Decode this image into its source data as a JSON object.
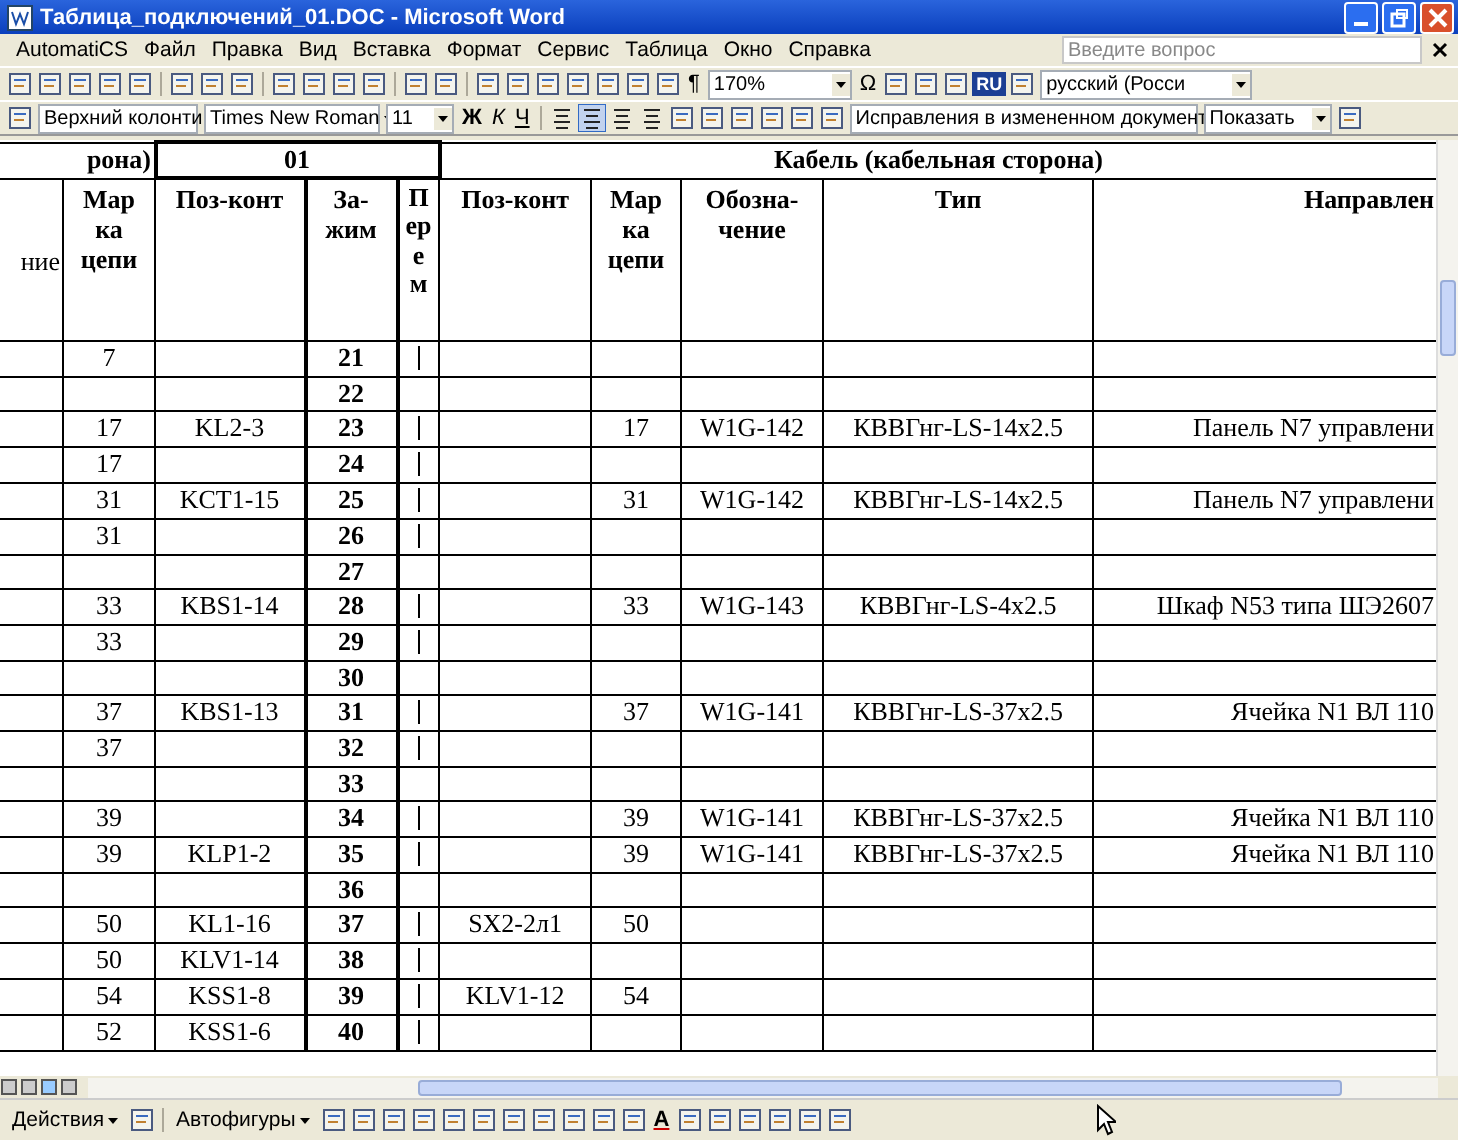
{
  "window": {
    "title": "Таблица_подключений_01.DOC - Microsoft Word"
  },
  "menu": [
    "AutomatiCS",
    "Файл",
    "Правка",
    "Вид",
    "Вставка",
    "Формат",
    "Сервис",
    "Таблица",
    "Окно",
    "Справка"
  ],
  "help_search": {
    "placeholder": "Введите вопрос"
  },
  "standard_toolbar": {
    "zoom": "170%",
    "omega": "Ω",
    "pilcrow": "¶",
    "language_badge": "RU",
    "language": "русский (Росси"
  },
  "formatting_toolbar": {
    "style": "Верхний колонти",
    "font": "Times New Roman",
    "size": "11",
    "bold": "Ж",
    "italic": "К",
    "underline": "Ч",
    "alignment_buttons": [
      {
        "selected": false
      },
      {
        "selected": true
      },
      {
        "selected": false
      },
      {
        "selected": false
      }
    ]
  },
  "reviewing_toolbar": {
    "display": "Исправления в измененном документ",
    "show": "Показать"
  },
  "table": {
    "header_groups": [
      {
        "label": "рона)"
      },
      {
        "label": "01"
      },
      {
        "label": "Кабель (кабельная сторона)"
      }
    ],
    "columns": [
      {
        "label": "ние",
        "kind": "plain"
      },
      {
        "label": "Мар\nка\nцепи",
        "kind": "plain"
      },
      {
        "label": "Поз-конт",
        "kind": "plain"
      },
      {
        "label": "За-\nжим",
        "kind": "terminal"
      },
      {
        "label": "Перем",
        "kind": "vertical"
      },
      {
        "label": "Поз-конт",
        "kind": "plain"
      },
      {
        "label": "Мар\nка\nцепи",
        "kind": "plain"
      },
      {
        "label": "Обозна-\nчение",
        "kind": "plain"
      },
      {
        "label": "Тип",
        "kind": "plain"
      },
      {
        "label": "Направлен",
        "kind": "right"
      }
    ],
    "rows": [
      {
        "mark": "7",
        "terminal": "21",
        "jumper": true
      },
      {
        "terminal": "22",
        "jumper": false
      },
      {
        "mark": "17",
        "pos": "KL2-3",
        "terminal": "23",
        "jumper": true,
        "mark_2": "17",
        "designation": "W1G-142",
        "type": "КВВГнг-LS-14x2.5",
        "direction": "Панель N7 управлени"
      },
      {
        "mark": "17",
        "terminal": "24",
        "jumper": true
      },
      {
        "mark": "31",
        "pos": "KCT1-15",
        "terminal": "25",
        "jumper": true,
        "mark_2": "31",
        "designation": "W1G-142",
        "type": "КВВГнг-LS-14x2.5",
        "direction": "Панель N7 управлени"
      },
      {
        "mark": "31",
        "terminal": "26",
        "jumper": true
      },
      {
        "terminal": "27",
        "jumper": false
      },
      {
        "mark": "33",
        "pos": "KBS1-14",
        "terminal": "28",
        "jumper": true,
        "mark_2": "33",
        "designation": "W1G-143",
        "type": "КВВГнг-LS-4x2.5",
        "direction": "Шкаф N53 типа ШЭ2607"
      },
      {
        "mark": "33",
        "terminal": "29",
        "jumper": true
      },
      {
        "terminal": "30",
        "jumper": false
      },
      {
        "mark": "37",
        "pos": "KBS1-13",
        "terminal": "31",
        "jumper": true,
        "mark_2": "37",
        "designation": "W1G-141",
        "type": "КВВГнг-LS-37x2.5",
        "direction": "Ячейка N1 ВЛ 110"
      },
      {
        "mark": "37",
        "terminal": "32",
        "jumper": true
      },
      {
        "terminal": "33",
        "jumper": false
      },
      {
        "mark": "39",
        "terminal": "34",
        "jumper": true,
        "mark_2": "39",
        "designation": "W1G-141",
        "type": "КВВГнг-LS-37x2.5",
        "direction": "Ячейка N1 ВЛ 110"
      },
      {
        "mark": "39",
        "pos": "KLP1-2",
        "terminal": "35",
        "jumper": true,
        "mark_2": "39",
        "designation": "W1G-141",
        "type": "КВВГнг-LS-37x2.5",
        "direction": "Ячейка N1 ВЛ 110"
      },
      {
        "terminal": "36",
        "jumper": false
      },
      {
        "mark": "50",
        "pos": "KL1-16",
        "terminal": "37",
        "jumper": true,
        "pos_2": "SX2-2л1",
        "mark_2": "50"
      },
      {
        "mark": "50",
        "pos": "KLV1-14",
        "terminal": "38",
        "jumper": true
      },
      {
        "mark": "54",
        "pos": "KSS1-8",
        "terminal": "39",
        "jumper": true,
        "pos_2": "KLV1-12",
        "mark_2": "54"
      },
      {
        "mark": "52",
        "pos": "KSS1-6",
        "terminal": "40",
        "jumper": true
      }
    ]
  },
  "drawing_toolbar": {
    "actions": "Действия",
    "autoshapes": "Автофигуры",
    "font_color": "A"
  }
}
